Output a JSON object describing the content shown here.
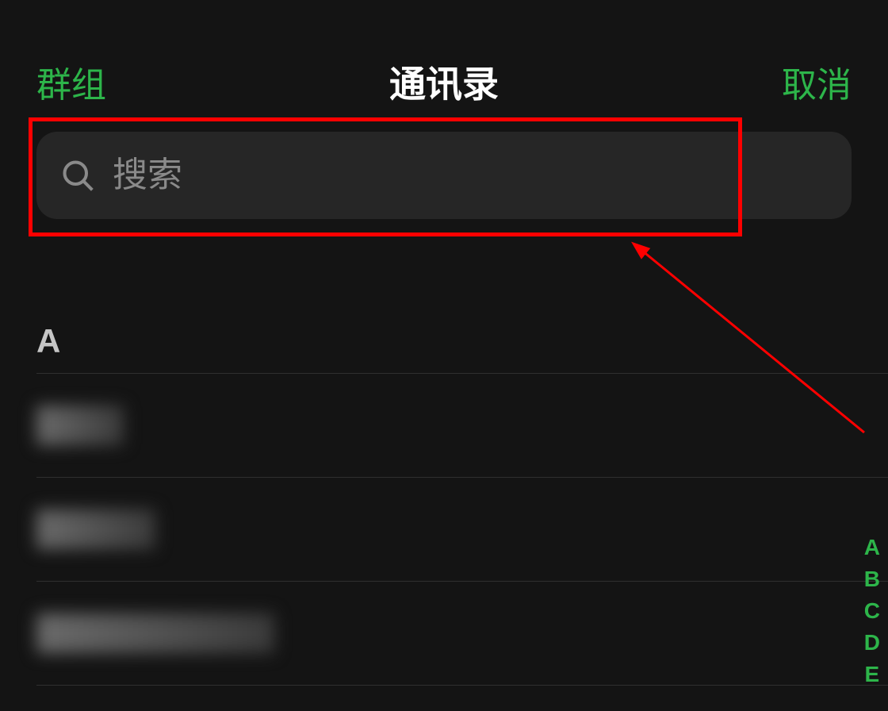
{
  "header": {
    "groups_label": "群组",
    "title": "通讯录",
    "cancel_label": "取消"
  },
  "search": {
    "placeholder": "搜索"
  },
  "section": {
    "letter": "A"
  },
  "contacts": [
    {
      "name": "████"
    },
    {
      "name": "██████"
    },
    {
      "name": "██████████"
    }
  ],
  "index_letters": [
    "A",
    "B",
    "C",
    "D",
    "E"
  ],
  "colors": {
    "accent": "#2db54a",
    "background": "#141414",
    "highlight": "#ff0000"
  }
}
